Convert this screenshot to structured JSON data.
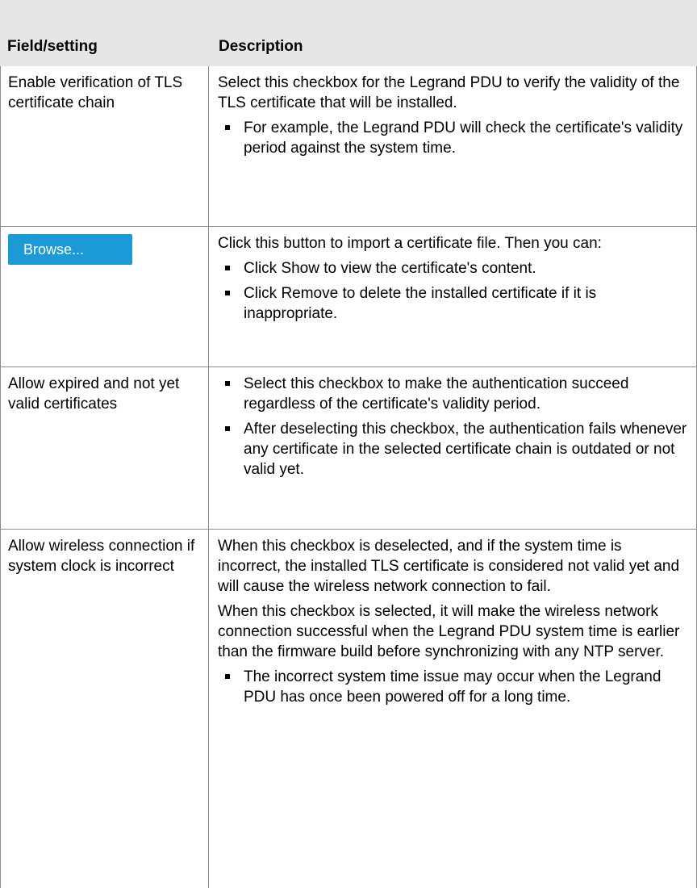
{
  "table": {
    "headers": {
      "field": "Field/setting",
      "description": "Description"
    },
    "rows": [
      {
        "field": "Enable verification of TLS certificate chain",
        "paras": [
          "Select this checkbox for the Legrand PDU to verify the validity of the TLS certificate that will be installed."
        ],
        "bullets": [
          "For example, the Legrand PDU will check the certificate's validity period against the system time."
        ]
      },
      {
        "button_label": "Browse...",
        "paras": [
          "Click this button to import a certificate file. Then you can:"
        ],
        "bullets": [
          "Click Show to view the certificate's content.",
          "Click Remove to delete the installed certificate if it is inappropriate."
        ]
      },
      {
        "field": "Allow expired and not yet valid certificates",
        "bullets": [
          "Select this checkbox to make the authentication succeed regardless of the certificate's validity period.",
          "After deselecting this checkbox, the authentication fails whenever any certificate in the selected certificate chain is outdated or not valid yet."
        ]
      },
      {
        "field": "Allow wireless connection if system clock is incorrect",
        "paras": [
          "When this checkbox is deselected, and if the system time is incorrect, the installed TLS certificate is considered not valid yet and will cause the wireless network connection to fail.",
          "When this checkbox is selected, it will make the wireless network connection successful when the Legrand PDU system time is earlier than the firmware build before synchronizing with any NTP server."
        ],
        "bullets": [
          "The incorrect system time issue may occur when the Legrand PDU has once been powered off for a long time."
        ]
      }
    ]
  },
  "colors": {
    "header_bg": "#e6e6e6",
    "button_bg": "#1b9ad6",
    "border": "#8c8c8c"
  }
}
